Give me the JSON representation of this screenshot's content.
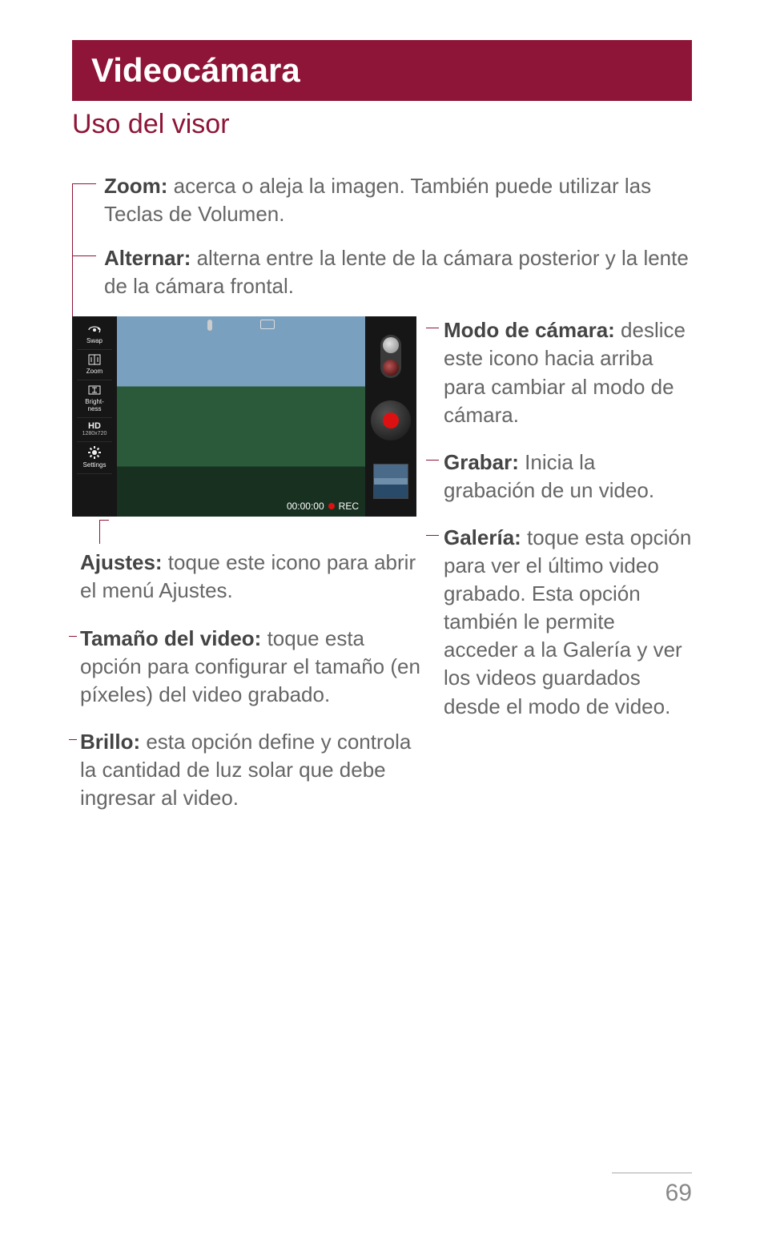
{
  "title": "Videocámara",
  "subtitle": "Uso del visor",
  "defs": {
    "zoom": {
      "label": "Zoom:",
      "text": " acerca o aleja la imagen. También puede utilizar las Teclas de Volumen."
    },
    "alternar": {
      "label": "Alternar:",
      "text": " alterna entre la lente de la cámara posterior y la lente de la cámara frontal."
    },
    "modo_camara": {
      "label": "Modo de cámara:",
      "text": " deslice este icono hacia arriba para cambiar al modo de cámara."
    },
    "grabar": {
      "label": "Grabar:",
      "text": " Inicia la grabación de un video."
    },
    "galeria": {
      "label": "Galería:",
      "text": " toque esta opción para ver el último video grabado. Esta opción también le permite acceder a la Galería y ver los videos guardados desde el modo de video."
    },
    "ajustes": {
      "label": "Ajustes:",
      "text": " toque este icono para abrir el menú Ajustes."
    },
    "tamano": {
      "label": "Tamaño del video:",
      "text": " toque esta opción para configurar el tamaño (en píxeles) del video grabado."
    },
    "brillo": {
      "label": "Brillo:",
      "text": " esta opción define y controla la cantidad de luz solar que debe ingresar al video."
    }
  },
  "sidebar_icons": {
    "swap": "Swap",
    "zoom": "Zoom",
    "brightness": "Bright-\nness",
    "hd": "HD",
    "hd_res": "1280x720",
    "settings": "Settings"
  },
  "viewfinder": {
    "timer": "00:00:00",
    "rec": "REC"
  },
  "page_number": "69"
}
